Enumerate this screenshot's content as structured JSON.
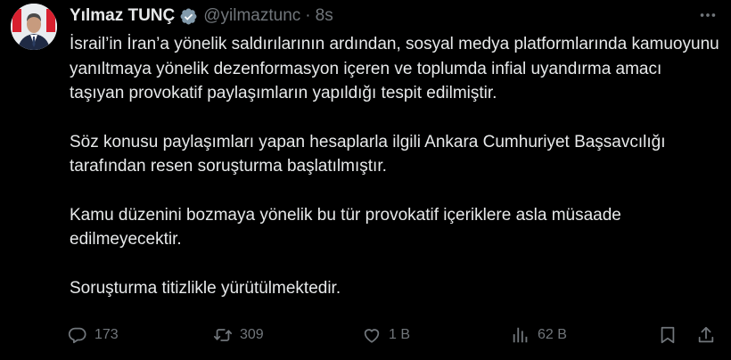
{
  "author": {
    "name": "Yılmaz TUNÇ",
    "handle": "@yilmaztunc",
    "separator": "·",
    "time": "8s"
  },
  "tweet": {
    "paragraphs": [
      "İsrail’in İran’a yönelik saldırılarının ardından, sosyal medya platformlarında kamuoyunu yanıltmaya yönelik dezenformasyon içeren ve toplumda infial uyandırma amacı taşıyan provokatif paylaşımların yapıldığı tespit edilmiştir.",
      "Söz konusu paylaşımları yapan hesaplarla ilgili Ankara Cumhuriyet Başsavcılığı tarafından resen soruşturma başlatılmıştır.",
      "Kamu düzenini bozmaya yönelik bu tür provokatif içeriklere asla müsaade edilmeyecektir.",
      "Soruşturma titizlikle yürütülmektedir."
    ]
  },
  "actions": {
    "reply_count": "173",
    "repost_count": "309",
    "like_count": "1 B",
    "view_count": "62 B"
  },
  "icons": {
    "verified": "verified-badge-icon",
    "more": "more-horizontal-icon",
    "reply": "reply-icon",
    "repost": "repost-icon",
    "like": "heart-icon",
    "views": "analytics-icon",
    "bookmark": "bookmark-icon",
    "share": "share-icon"
  },
  "colors": {
    "background": "#000000",
    "text": "#e7e9ea",
    "secondary": "#71767b",
    "verified": "#829aab"
  }
}
